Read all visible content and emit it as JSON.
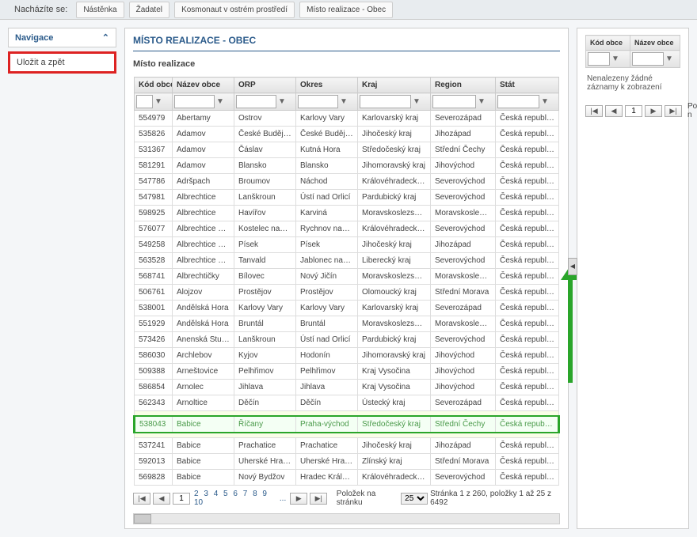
{
  "breadcrumb": {
    "label": "Nacházíte se:",
    "items": [
      "Nástěnka",
      "Žadatel",
      "Kosmonaut v ostrém prostředí",
      "Místo realizace - Obec"
    ]
  },
  "nav": {
    "title": "Navigace",
    "chevron": "⌃",
    "save_back": "Uložit a zpět"
  },
  "panel": {
    "title": "MÍSTO REALIZACE - OBEC",
    "subtitle": "Místo realizace"
  },
  "headers": {
    "kod": "Kód obce",
    "nazev": "Název obce",
    "orp": "ORP",
    "okres": "Okres",
    "kraj": "Kraj",
    "region": "Region",
    "stat": "Stát"
  },
  "rows": [
    {
      "kod": "554979",
      "nazev": "Abertamy",
      "orp": "Ostrov",
      "okres": "Karlovy Vary",
      "kraj": "Karlovarský kraj",
      "region": "Severozápad",
      "stat": "Česká republika"
    },
    {
      "kod": "535826",
      "nazev": "Adamov",
      "orp": "České Budějovice",
      "okres": "České Budějovice",
      "kraj": "Jihočeský kraj",
      "region": "Jihozápad",
      "stat": "Česká republika"
    },
    {
      "kod": "531367",
      "nazev": "Adamov",
      "orp": "Čáslav",
      "okres": "Kutná Hora",
      "kraj": "Středočeský kraj",
      "region": "Střední Čechy",
      "stat": "Česká republika"
    },
    {
      "kod": "581291",
      "nazev": "Adamov",
      "orp": "Blansko",
      "okres": "Blansko",
      "kraj": "Jihomoravský kraj",
      "region": "Jihovýchod",
      "stat": "Česká republika"
    },
    {
      "kod": "547786",
      "nazev": "Adršpach",
      "orp": "Broumov",
      "okres": "Náchod",
      "kraj": "Královéhradecký kraj",
      "region": "Severovýchod",
      "stat": "Česká republika"
    },
    {
      "kod": "547981",
      "nazev": "Albrechtice",
      "orp": "Lanškroun",
      "okres": "Ústí nad Orlicí",
      "kraj": "Pardubický kraj",
      "region": "Severovýchod",
      "stat": "Česká republika"
    },
    {
      "kod": "598925",
      "nazev": "Albrechtice",
      "orp": "Havířov",
      "okres": "Karviná",
      "kraj": "Moravskoslezský kraj",
      "region": "Moravskoslezsko",
      "stat": "Česká republika"
    },
    {
      "kod": "576077",
      "nazev": "Albrechtice nad...",
      "orp": "Kostelec nad Orlicí",
      "okres": "Rychnov nad Kně...",
      "kraj": "Královéhradecký kraj",
      "region": "Severovýchod",
      "stat": "Česká republika"
    },
    {
      "kod": "549258",
      "nazev": "Albrechtice nad...",
      "orp": "Písek",
      "okres": "Písek",
      "kraj": "Jihočeský kraj",
      "region": "Jihozápad",
      "stat": "Česká republika"
    },
    {
      "kod": "563528",
      "nazev": "Albrechtice v Jiz...",
      "orp": "Tanvald",
      "okres": "Jablonec nad Nis...",
      "kraj": "Liberecký kraj",
      "region": "Severovýchod",
      "stat": "Česká republika"
    },
    {
      "kod": "568741",
      "nazev": "Albrechtičky",
      "orp": "Bílovec",
      "okres": "Nový Jičín",
      "kraj": "Moravskoslezský kraj",
      "region": "Moravskoslezsko",
      "stat": "Česká republika"
    },
    {
      "kod": "506761",
      "nazev": "Alojzov",
      "orp": "Prostějov",
      "okres": "Prostějov",
      "kraj": "Olomoucký kraj",
      "region": "Střední Morava",
      "stat": "Česká republika"
    },
    {
      "kod": "538001",
      "nazev": "Andělská Hora",
      "orp": "Karlovy Vary",
      "okres": "Karlovy Vary",
      "kraj": "Karlovarský kraj",
      "region": "Severozápad",
      "stat": "Česká republika"
    },
    {
      "kod": "551929",
      "nazev": "Andělská Hora",
      "orp": "Bruntál",
      "okres": "Bruntál",
      "kraj": "Moravskoslezský kraj",
      "region": "Moravskoslezsko",
      "stat": "Česká republika"
    },
    {
      "kod": "573426",
      "nazev": "Anenská Studánka",
      "orp": "Lanškroun",
      "okres": "Ústí nad Orlicí",
      "kraj": "Pardubický kraj",
      "region": "Severovýchod",
      "stat": "Česká republika"
    },
    {
      "kod": "586030",
      "nazev": "Archlebov",
      "orp": "Kyjov",
      "okres": "Hodonín",
      "kraj": "Jihomoravský kraj",
      "region": "Jihovýchod",
      "stat": "Česká republika"
    },
    {
      "kod": "509388",
      "nazev": "Arneštovice",
      "orp": "Pelhřimov",
      "okres": "Pelhřimov",
      "kraj": "Kraj Vysočina",
      "region": "Jihovýchod",
      "stat": "Česká republika"
    },
    {
      "kod": "586854",
      "nazev": "Arnolec",
      "orp": "Jihlava",
      "okres": "Jihlava",
      "kraj": "Kraj Vysočina",
      "region": "Jihovýchod",
      "stat": "Česká republika"
    },
    {
      "kod": "562343",
      "nazev": "Arnoltice",
      "orp": "Děčín",
      "okres": "Děčín",
      "kraj": "Ústecký kraj",
      "region": "Severozápad",
      "stat": "Česká republika"
    },
    {
      "kod": "538043",
      "nazev": "Babice",
      "orp": "Říčany",
      "okres": "Praha-východ",
      "kraj": "Středočeský kraj",
      "region": "Střední Čechy",
      "stat": "Česká republika",
      "hl": true
    },
    {
      "kod": "537241",
      "nazev": "Babice",
      "orp": "Prachatice",
      "okres": "Prachatice",
      "kraj": "Jihočeský kraj",
      "region": "Jihozápad",
      "stat": "Česká republika"
    },
    {
      "kod": "592013",
      "nazev": "Babice",
      "orp": "Uherské Hradiště",
      "okres": "Uherské Hradiště",
      "kraj": "Zlínský kraj",
      "region": "Střední Morava",
      "stat": "Česká republika"
    },
    {
      "kod": "569828",
      "nazev": "Babice",
      "orp": "Nový Bydžov",
      "okres": "Hradec Králové",
      "kraj": "Královéhradecký kraj",
      "region": "Severovýchod",
      "stat": "Česká republika"
    }
  ],
  "pager": {
    "pages": [
      "1",
      "2",
      "3",
      "4",
      "5",
      "6",
      "7",
      "8",
      "9",
      "10"
    ],
    "ellipsis": "...",
    "sep": "|",
    "curr": "1",
    "items_per_page_label": "Položek na stránku",
    "items_per_page": "25",
    "summary": "Stránka 1 z 260, položky 1 až 25 z 6492",
    "first": "|◀",
    "prev": "◀",
    "next": "▶",
    "last": "▶|"
  },
  "right_panel": {
    "no_records": "Nenalezeny žádné záznamy k zobrazení",
    "items_label": "Položek n"
  },
  "icons": {
    "expand_right": "▶",
    "expand_left": "◀",
    "filter": "▼"
  }
}
